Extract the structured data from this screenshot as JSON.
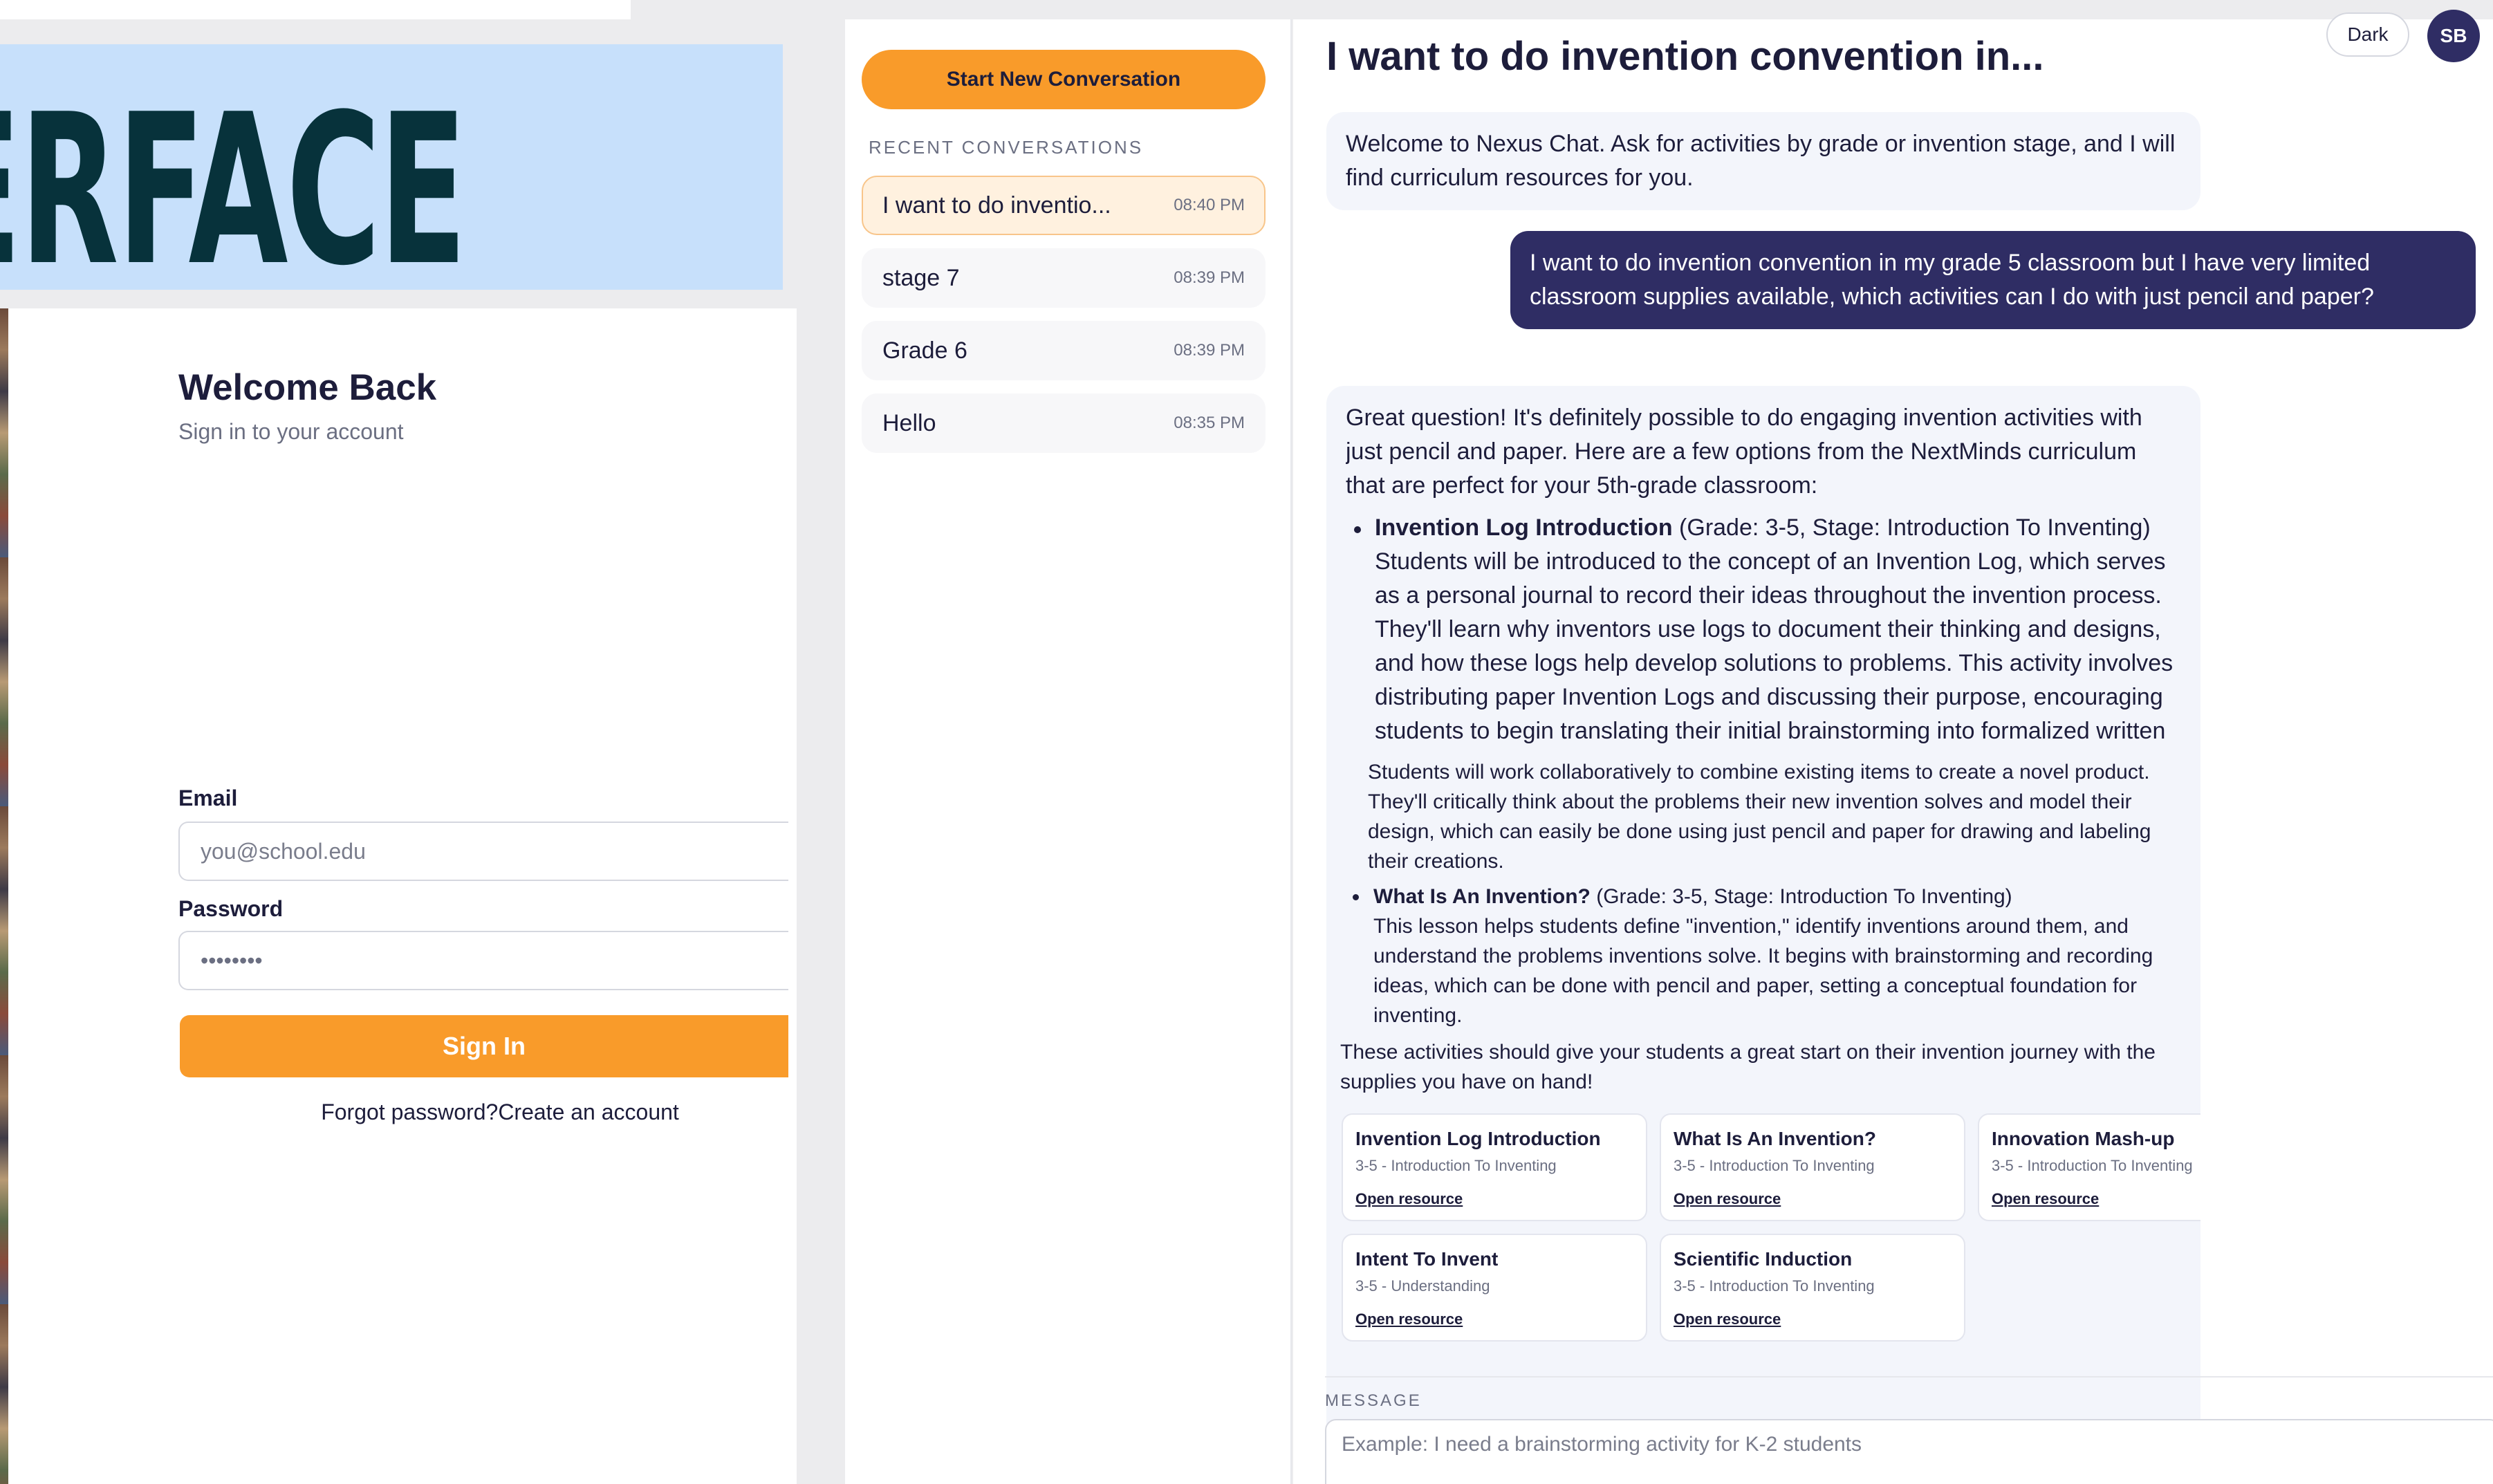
{
  "banner": {
    "text": "ERFACE"
  },
  "login": {
    "title": "Welcome Back",
    "subtitle": "Sign in to your account",
    "email_label": "Email",
    "email_placeholder": "you@school.edu",
    "password_label": "Password",
    "password_value": "••••••••",
    "signin_label": "Sign In",
    "forgot_label": "Forgot password?",
    "create_label": "Create an account"
  },
  "sidebar": {
    "new_conversation_label": "Start New Conversation",
    "recent_label": "RECENT CONVERSATIONS",
    "conversations": [
      {
        "title": "I want to do inventio...",
        "time": "08:40 PM",
        "active": true
      },
      {
        "title": "stage 7",
        "time": "08:39 PM",
        "active": false
      },
      {
        "title": "Grade 6",
        "time": "08:39 PM",
        "active": false
      },
      {
        "title": "Hello",
        "time": "08:35 PM",
        "active": false
      }
    ]
  },
  "header": {
    "title": "I want to do invention convention in...",
    "theme_label": "Dark",
    "avatar_initials": "SB"
  },
  "messages": {
    "welcome": "Welcome to Nexus Chat. Ask for activities by grade or invention stage, and I will find curriculum resources for you.",
    "user": "I want to do invention convention in my grade 5 classroom but I have very limited classroom supplies available, which activities can I do with just pencil and paper?",
    "reply_intro": "Great question! It's definitely possible to do engaging invention activities with just pencil and paper. Here are a few options from the NextMinds curriculum that are perfect for your 5th-grade classroom:",
    "item1_name": "Invention Log Introduction",
    "item1_meta": " (Grade: 3-5, Stage: Introduction To Inventing)",
    "item1_desc": "Students will be introduced to the concept of an Invention Log, which serves as a personal journal to record their ideas throughout the invention process. They'll learn why inventors use logs to document their thinking and designs, and how these logs help develop solutions to problems. This activity involves distributing paper Invention Logs and discussing their purpose, encouraging students to begin translating their initial brainstorming into formalized written",
    "item2_tail": "Students will work collaboratively to combine existing items to create a novel product. They'll critically think about the problems their new invention solves and model their design, which can easily be done using just pencil and paper for drawing and labeling their creations.",
    "item3_name": "What Is An Invention?",
    "item3_meta": " (Grade: 3-5, Stage: Introduction To Inventing)",
    "item3_desc": "This lesson helps students define \"invention,\" identify inventions around them, and understand the problems inventions solve. It begins with brainstorming and recording ideas, which can be done with pencil and paper, setting a conceptual foundation for inventing.",
    "closing": "These activities should give your students a great start on their invention journey with the supplies you have on hand!"
  },
  "resources": [
    {
      "title": "Invention Log Introduction",
      "meta": "3-5 - Introduction To Inventing",
      "link": "Open resource"
    },
    {
      "title": "What Is An Invention?",
      "meta": "3-5 - Introduction To Inventing",
      "link": "Open resource"
    },
    {
      "title": "Innovation Mash-up",
      "meta": "3-5 - Introduction To Inventing",
      "link": "Open resource"
    },
    {
      "title": "Intent To Invent",
      "meta": "3-5 - Understanding",
      "link": "Open resource"
    },
    {
      "title": "Scientific Induction",
      "meta": "3-5 - Introduction To Inventing",
      "link": "Open resource"
    }
  ],
  "composer": {
    "label": "MESSAGE",
    "placeholder": "Example: I need a brainstorming activity for K-2 students"
  }
}
